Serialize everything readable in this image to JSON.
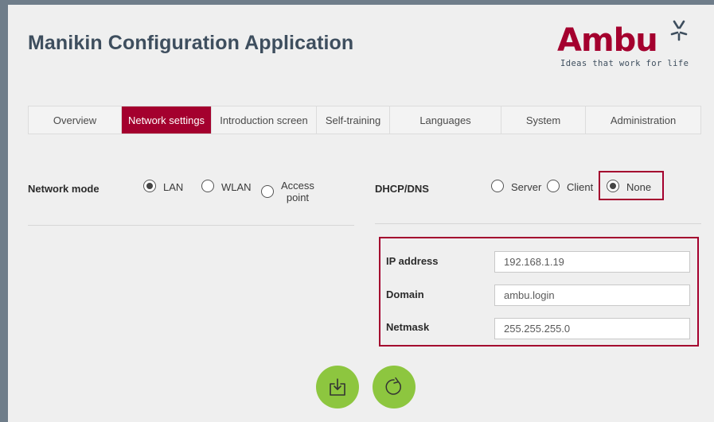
{
  "app": {
    "title": "Manikin Configuration Application"
  },
  "logo": {
    "wordmark": "Ambu",
    "tagline": "Ideas that work for life",
    "color": "#a4002e"
  },
  "tabs": [
    {
      "label": "Overview",
      "active": false
    },
    {
      "label": "Network settings",
      "active": true
    },
    {
      "label": "Introduction screen",
      "active": false
    },
    {
      "label": "Self-training",
      "active": false
    },
    {
      "label": "Languages",
      "active": false
    },
    {
      "label": "System",
      "active": false
    },
    {
      "label": "Administration",
      "active": false
    }
  ],
  "network_mode": {
    "label": "Network mode",
    "options": [
      {
        "label": "LAN",
        "checked": true
      },
      {
        "label": "WLAN",
        "checked": false
      },
      {
        "label_line1": "Access",
        "label_line2": "point",
        "checked": false
      }
    ]
  },
  "dhcp_dns": {
    "label": "DHCP/DNS",
    "options": [
      {
        "label": "Server",
        "checked": false
      },
      {
        "label": "Client",
        "checked": false
      },
      {
        "label": "None",
        "checked": true
      }
    ]
  },
  "fields": {
    "ip_address": {
      "label": "IP address",
      "value": "192.168.1.19"
    },
    "domain": {
      "label": "Domain",
      "value": "ambu.login"
    },
    "netmask": {
      "label": "Netmask",
      "value": "255.255.255.0"
    }
  },
  "actions": {
    "save_icon": "download-tray-icon",
    "refresh_icon": "refresh-icon",
    "button_color": "#8dc63f"
  }
}
